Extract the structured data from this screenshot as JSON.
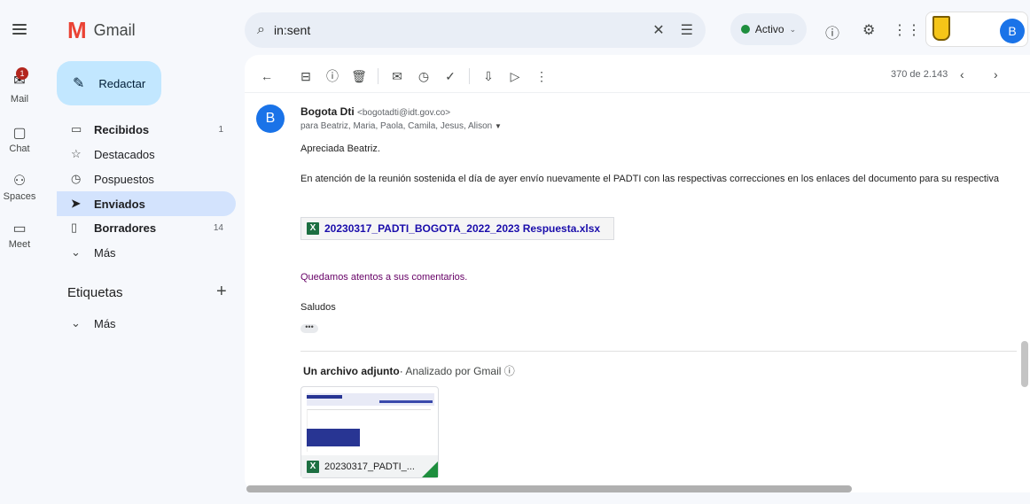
{
  "app": {
    "name": "Gmail"
  },
  "search": {
    "value": "in:sent"
  },
  "status": {
    "label": "Activo",
    "color": "#1e8e3e"
  },
  "account": {
    "initial": "B"
  },
  "rail": {
    "mail_label": "Mail",
    "mail_badge": "1",
    "chat_label": "Chat",
    "spaces_label": "Spaces",
    "meet_label": "Meet"
  },
  "compose": {
    "label": "Redactar"
  },
  "nav": {
    "inbox_label": "Recibidos",
    "inbox_count": "1",
    "starred_label": "Destacados",
    "snoozed_label": "Pospuestos",
    "sent_label": "Enviados",
    "drafts_label": "Borradores",
    "drafts_count": "14",
    "more_label": "Más"
  },
  "labels": {
    "title": "Etiquetas",
    "more_label": "Más"
  },
  "toolbar": {
    "pager": "370 de 2.143"
  },
  "email": {
    "sender_initial": "B",
    "sender_name": "Bogota Dti",
    "sender_email": "<bogotadti@idt.gov.co>",
    "recipients": "para Beatriz, Maria, Paola, Camila, Jesus, Alison",
    "greeting": "Apreciada Beatriz.",
    "body": "En atención de la reunión sostenida el día de ayer envío nuevamente el PADTI con las respectivas correcciones en los enlaces del documento para su respectiva",
    "attachment_link": "20230317_PADTI_BOGOTA_2022_2023 Respuesta.xlsx",
    "closing": "Quedamos atentos a sus comentarios.",
    "signoff": "Saludos",
    "ellipsis": "•••"
  },
  "attachments": {
    "title": "Un archivo adjunto",
    "scanned": " Analizado por Gmail ⓘ",
    "file_name": "20230317_PADTI_..."
  },
  "colors": {
    "accent": "#1a73e8",
    "compose_bg": "#c2e7ff",
    "active_nav": "#d3e3fd",
    "excel": "#1d6f42"
  }
}
